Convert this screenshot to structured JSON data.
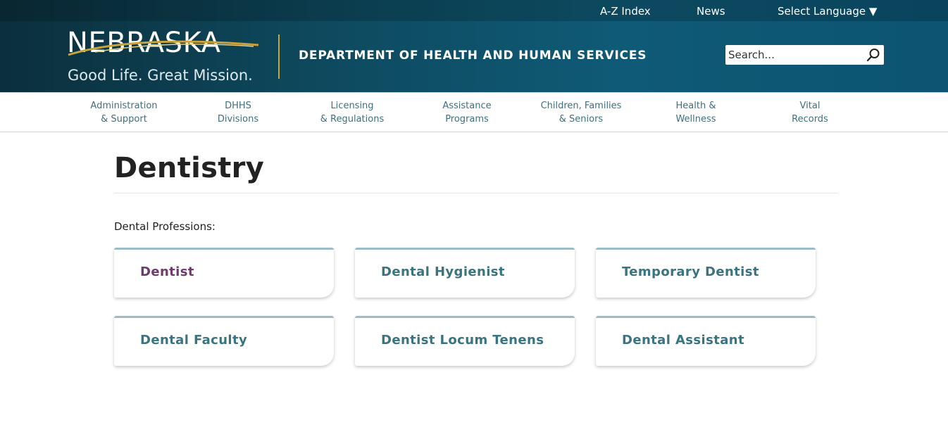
{
  "topbar": {
    "az_index": "A-Z Index",
    "news": "News",
    "select_language": "Select Language ▼"
  },
  "logo": {
    "wordmark": "NEBRASKA",
    "tagline": "Good Life. Great Mission."
  },
  "department_name": "DEPARTMENT OF HEALTH AND HUMAN SERVICES",
  "search": {
    "placeholder": "Search...",
    "icon": "search-icon"
  },
  "nav": {
    "items": [
      {
        "line1": "Administration",
        "line2": "& Support"
      },
      {
        "line1": "DHHS",
        "line2": "Divisions"
      },
      {
        "line1": "Licensing",
        "line2": "& Regulations"
      },
      {
        "line1": "Assistance",
        "line2": "Programs"
      },
      {
        "line1": "Children, Families",
        "line2": "& Seniors"
      },
      {
        "line1": "Health &",
        "line2": "Wellness"
      },
      {
        "line1": "Vital",
        "line2": "Records"
      }
    ]
  },
  "main": {
    "title": "Dentistry",
    "section_label": "Dental Professions:",
    "cards": [
      {
        "label": "Dentist"
      },
      {
        "label": "Dental Hygienist"
      },
      {
        "label": "Temporary Dentist"
      },
      {
        "label": "Dental Faculty"
      },
      {
        "label": "Dentist Locum Tenens"
      },
      {
        "label": "Dental Assistant"
      }
    ]
  },
  "colors": {
    "header_dark": "#0b2f3c",
    "header_blue": "#0f5a76",
    "gold_accent": "#c9a23b",
    "card_link": "#3a7382",
    "card_link_visited": "#6e3a6f",
    "card_top_border": "#9dbbc6"
  }
}
